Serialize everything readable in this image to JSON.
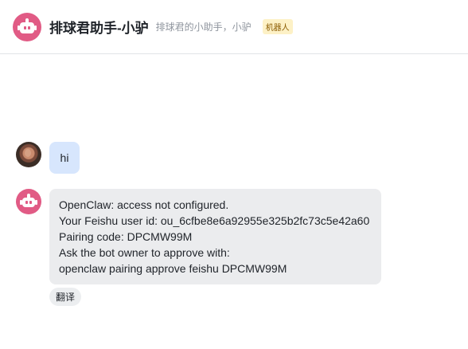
{
  "header": {
    "title": "排球君助手-小驴",
    "subtitle": "排球君的小助手，小驴",
    "badge": "机器人"
  },
  "messages": [
    {
      "sender": "user",
      "text": "hi"
    },
    {
      "sender": "bot",
      "lines": [
        "OpenClaw: access not configured.",
        "Your Feishu user id: ou_6cfbe8e6a92955e325b2fc73c5e42a60",
        "Pairing code: DPCMW99M",
        "Ask the bot owner to approve with:",
        "openclaw pairing approve feishu DPCMW99M"
      ]
    }
  ],
  "actions": {
    "translate_label": "翻译"
  },
  "colors": {
    "bot_avatar": "#e15b85",
    "user_bubble": "#d7e6fd",
    "bot_bubble": "#ebecee",
    "badge_bg": "#fdf1c6",
    "badge_text": "#8a5a00"
  },
  "icons": {
    "bot_avatar": "robot-icon",
    "user_avatar": "user-photo"
  }
}
